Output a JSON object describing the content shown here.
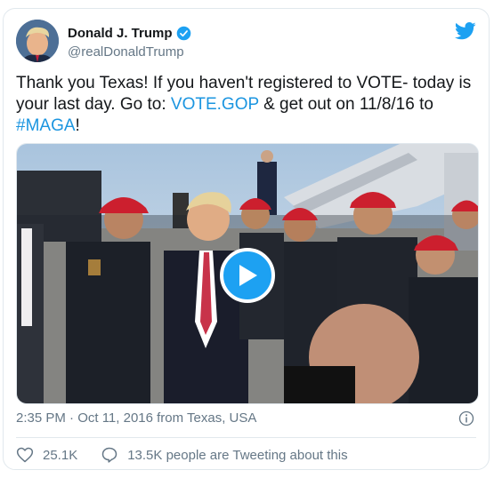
{
  "author": {
    "display_name": "Donald J. Trump",
    "handle": "@realDonaldTrump",
    "verified": true
  },
  "tweet": {
    "text_part1": "Thank you Texas! If you haven't registered to VOTE- today is your last day. Go to: ",
    "link_vote": "VOTE.GOP",
    "text_part2": " & get out on 11/8/16 to ",
    "hashtag": "#MAGA",
    "text_part3": "!"
  },
  "media": {
    "type": "video",
    "play_icon": "play-icon"
  },
  "meta": {
    "timestamp": "2:35 PM · Oct 11, 2016 from Texas, USA"
  },
  "actions": {
    "likes": "25.1K",
    "replies_text": "13.5K people are Tweeting about this"
  },
  "colors": {
    "accent": "#1da1f2",
    "link": "#1b95e0",
    "muted": "#657786",
    "border": "#e1e8ed"
  }
}
